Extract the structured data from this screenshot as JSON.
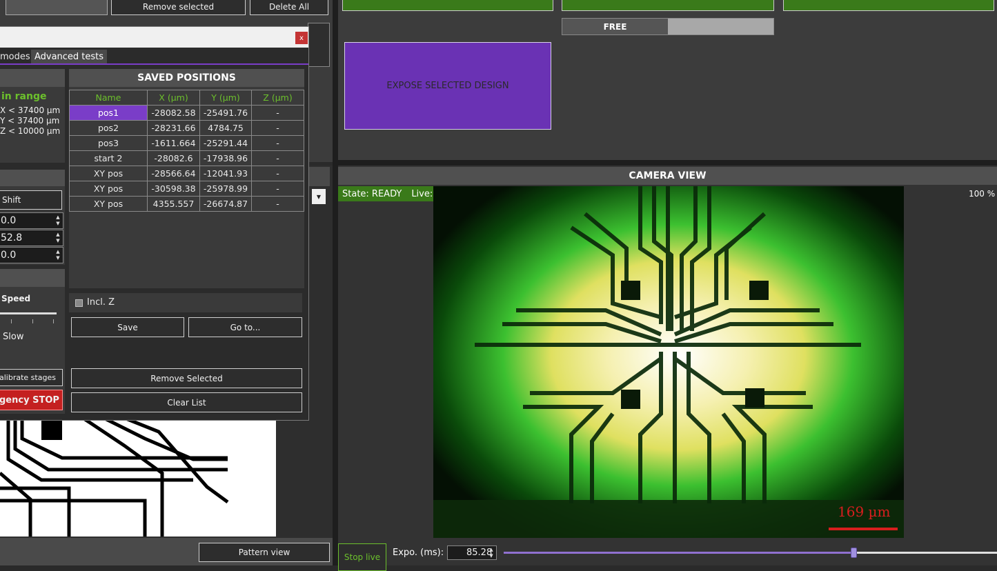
{
  "top_left_buttons": {
    "remove_selected": "Remove selected",
    "delete_all": "Delete All"
  },
  "dialog": {
    "close_label": "x",
    "tabs": [
      "modes",
      "Advanced tests"
    ],
    "range_title": "in range",
    "range_lines": [
      "X < 37400 µm",
      "Y < 37400 µm",
      "Z < 10000 µm"
    ],
    "shift_label": "Shift",
    "spin_values": [
      "0.0",
      "52.8",
      "0.0"
    ],
    "speed_label": "Speed",
    "slow_label": "Slow",
    "calibrate_label": "alibrate stages",
    "emergency_label": "gency STOP",
    "saved_positions": {
      "title": "SAVED POSITIONS",
      "columns": [
        "Name",
        "X (µm)",
        "Y (µm)",
        "Z (µm)"
      ],
      "rows": [
        [
          "pos1",
          "-28082.58",
          "-25491.76",
          "-"
        ],
        [
          "pos2",
          "-28231.66",
          "4784.75",
          "-"
        ],
        [
          "pos3",
          "-1611.664",
          "-25291.44",
          "-"
        ],
        [
          "start 2",
          "-28082.6",
          "-17938.96",
          "-"
        ],
        [
          "XY pos",
          "-28566.64",
          "-12041.93",
          "-"
        ],
        [
          "XY pos",
          "-30598.38",
          "-25978.99",
          "-"
        ],
        [
          "XY pos",
          "4355.557",
          "-26674.87",
          "-"
        ]
      ],
      "selected_row": 0,
      "incl_z_label": "Incl. Z",
      "save_label": "Save",
      "goto_label": "Go to...",
      "remove_label": "Remove Selected",
      "clear_label": "Clear List"
    }
  },
  "pattern_view_label": "Pattern view",
  "right_top": {
    "free_label": "FREE",
    "expose_label": "EXPOSE SELECTED DESIGN"
  },
  "camera": {
    "title": "CAMERA VIEW",
    "state_label": "State: READY",
    "live_label": "Live: ON",
    "zoom_label": "100 %",
    "scale_label": "169 µm",
    "stop_live_label": "Stop live",
    "expo_label": "Expo. (ms):",
    "expo_value": "85.28",
    "expo_slider_fraction": 0.71
  },
  "colors": {
    "accent_purple": "#7a3dc8",
    "green_button": "#3a7a1a",
    "emergency_red": "#c42020",
    "range_green": "#6cc02c"
  }
}
